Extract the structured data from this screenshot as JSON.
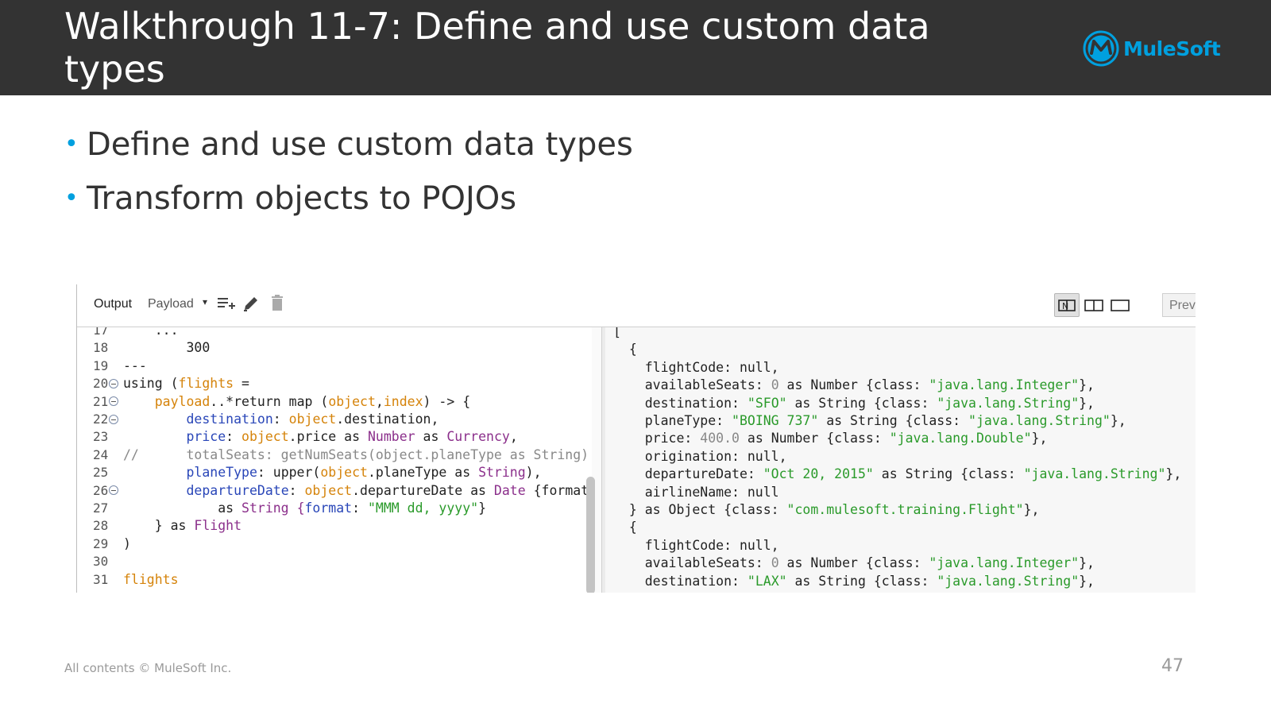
{
  "slide": {
    "title": "Walkthrough 11-7: Define and use custom data types",
    "logo_text": "MuleSoft",
    "bullets": [
      "Define and use custom data types",
      "Transform objects to POJOs"
    ],
    "footer": "All contents © MuleSoft Inc.",
    "page_number": "47"
  },
  "colors": {
    "header_bg": "#333333",
    "accent": "#00a0df",
    "keyword_var": "#d5830a",
    "key_blue": "#2946b8",
    "string_green": "#2a9a2a",
    "type_purple": "#8b2f8b"
  },
  "toolbar": {
    "output_label": "Output",
    "payload_label": "Payload",
    "payload_caret": "▾",
    "preview_label": "Prev",
    "icons": [
      "add-lines-icon",
      "pencil-icon",
      "trash-icon",
      "split-source-view-icon",
      "split-view-icon",
      "single-view-icon"
    ]
  },
  "editor": {
    "lines": [
      {
        "n": "17",
        "fold": false,
        "text": "    ..."
      },
      {
        "n": "18",
        "fold": false,
        "text": "        300"
      },
      {
        "n": "19",
        "fold": false,
        "text": "---"
      },
      {
        "n": "20",
        "fold": true,
        "text": "using (flights ="
      },
      {
        "n": "21",
        "fold": true,
        "text": "    payload..*return map (object,index) -> {"
      },
      {
        "n": "22",
        "fold": true,
        "text": "        destination: object.destination,"
      },
      {
        "n": "23",
        "fold": false,
        "text": "        price: object.price as Number as Currency,"
      },
      {
        "n": "24",
        "fold": false,
        "text": "//      totalSeats: getNumSeats(object.planeType as String)"
      },
      {
        "n": "25",
        "fold": false,
        "text": "        planeType: upper(object.planeType as String),"
      },
      {
        "n": "26",
        "fold": true,
        "text": "        departureDate: object.departureDate as Date {format"
      },
      {
        "n": "27",
        "fold": false,
        "text": "            as String {format: \"MMM dd, yyyy\"}"
      },
      {
        "n": "28",
        "fold": false,
        "text": "    } as Flight"
      },
      {
        "n": "29",
        "fold": false,
        "text": ")"
      },
      {
        "n": "30",
        "fold": false,
        "text": ""
      },
      {
        "n": "31",
        "fold": false,
        "text": "flights"
      }
    ]
  },
  "output": {
    "lines": [
      "[",
      "  {",
      "    flightCode: null,",
      "    availableSeats: 0 as Number {class: \"java.lang.Integer\"},",
      "    destination: \"SFO\" as String {class: \"java.lang.String\"},",
      "    planeType: \"BOING 737\" as String {class: \"java.lang.String\"},",
      "    price: 400.0 as Number {class: \"java.lang.Double\"},",
      "    origination: null,",
      "    departureDate: \"Oct 20, 2015\" as String {class: \"java.lang.String\"},",
      "    airlineName: null",
      "  } as Object {class: \"com.mulesoft.training.Flight\"},",
      "  {",
      "    flightCode: null,",
      "    availableSeats: 0 as Number {class: \"java.lang.Integer\"},",
      "    destination: \"LAX\" as String {class: \"java.lang.String\"},"
    ]
  }
}
